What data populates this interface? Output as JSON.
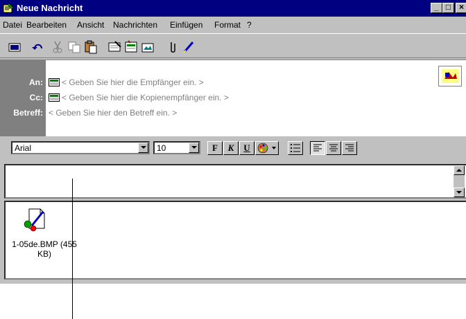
{
  "window": {
    "title": "Neue Nachricht",
    "controls": [
      "_",
      "□",
      "×"
    ]
  },
  "menu": [
    "Datei",
    "Bearbeiten",
    "Ansicht",
    "Nachrichten",
    "Einfügen",
    "Format",
    "?"
  ],
  "toolbar": {
    "icons": [
      "send-icon",
      "undo-icon",
      "cut-icon",
      "copy-icon",
      "paste-icon",
      "check-names-icon",
      "select-recipients-icon",
      "insert-file-icon",
      "attach-icon",
      "signature-icon"
    ]
  },
  "header": {
    "to_label": "An:",
    "to_placeholder": "< Geben Sie hier die Empfänger ein. >",
    "cc_label": "Cc:",
    "cc_placeholder": "< Geben Sie hier die Kopienempfänger ein. >",
    "subject_label": "Betreff:",
    "subject_placeholder": "< Geben Sie hier den Betreff ein. >"
  },
  "format": {
    "font": "Arial",
    "size": "10",
    "bold": "F",
    "italic": "K",
    "underline": "U"
  },
  "attachment": {
    "name_line1": "1-05de.BMP (455",
    "name_line2": "KB)"
  },
  "colors": {
    "titlebar": "#000080",
    "face": "#c0c0c0",
    "shadow": "#808080"
  }
}
